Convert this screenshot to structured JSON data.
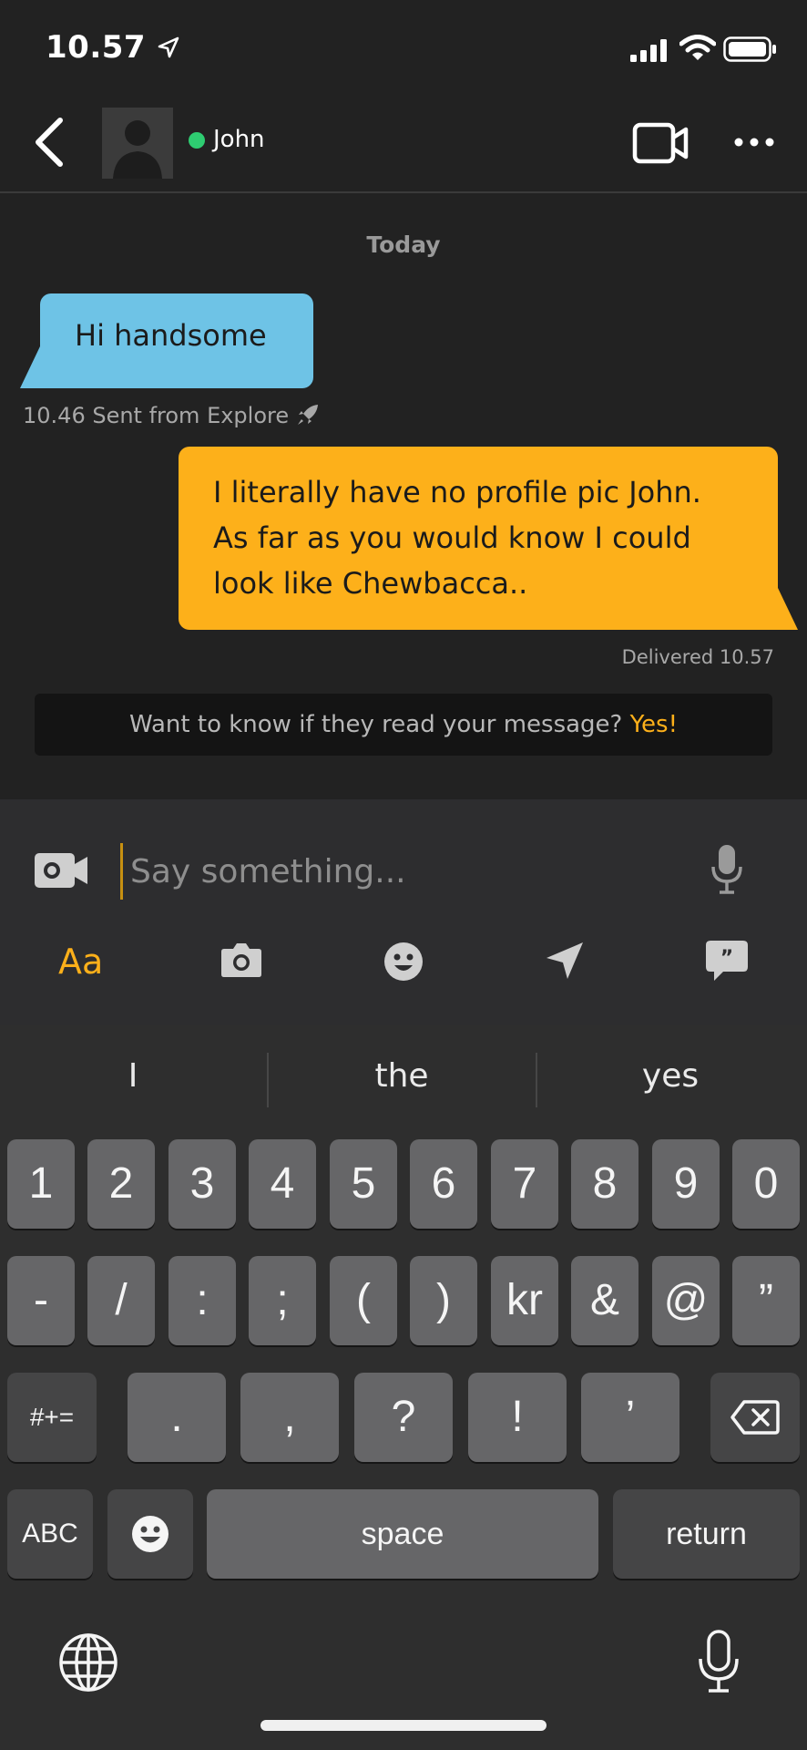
{
  "status_bar": {
    "time": "10.57"
  },
  "header": {
    "contact_name": "John"
  },
  "chat": {
    "date_label": "Today",
    "incoming": {
      "text": "Hi handsome",
      "meta": "10.46 Sent from Explore"
    },
    "outgoing": {
      "lines": [
        "I literally have no profile pic John.",
        "As far as you would know I could",
        "look like Chewbacca.."
      ],
      "meta": "Delivered 10.57"
    },
    "read_banner": {
      "text": "Want to know if they read your message?",
      "cta": "Yes!"
    }
  },
  "compose": {
    "placeholder": "Say something...",
    "format_label": "Aa"
  },
  "keyboard": {
    "suggestions": [
      "I",
      "the",
      "yes"
    ],
    "row1": [
      "1",
      "2",
      "3",
      "4",
      "5",
      "6",
      "7",
      "8",
      "9",
      "0"
    ],
    "row2": [
      "-",
      "/",
      ":",
      ";",
      "(",
      ")",
      "kr",
      "&",
      "@",
      "”"
    ],
    "row3": {
      "toggle": "#+=",
      "keys": [
        ".",
        ",",
        "?",
        "!",
        "’"
      ]
    },
    "row4": {
      "abc": "ABC",
      "space": "space",
      "return": "return"
    }
  },
  "colors": {
    "incoming_bubble": "#6ec3e6",
    "outgoing_bubble": "#fdb01a",
    "online": "#2ecc71",
    "accent": "#fdb01a"
  }
}
